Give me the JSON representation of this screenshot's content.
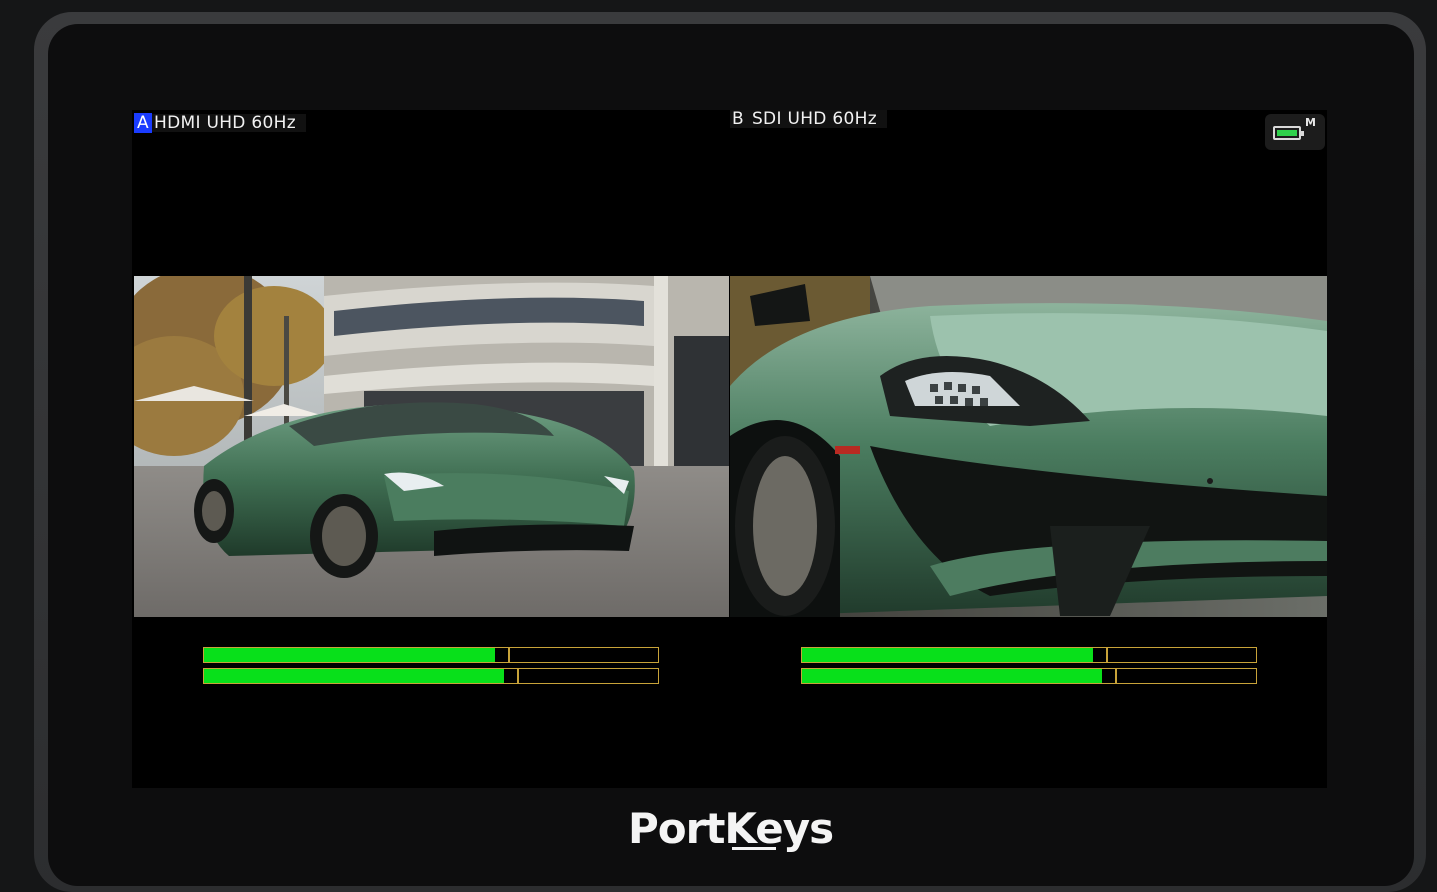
{
  "screen": {
    "source_a": {
      "badge": "A",
      "label": "HDMI  UHD  60Hz"
    },
    "source_b": {
      "badge": "B",
      "label": "SDI  UHD  60Hz"
    },
    "status": {
      "battery_icon": "battery-icon",
      "battery_mode": "M",
      "battery_color": "#2fd14b"
    }
  },
  "views": {
    "a": {
      "description_icon": "car-wide-shot-image"
    },
    "b": {
      "description_icon": "car-closeup-image"
    }
  },
  "audio_meters": {
    "a": [
      {
        "level": 0.64,
        "peak": 0.67
      },
      {
        "level": 0.66,
        "peak": 0.69
      }
    ],
    "b": [
      {
        "level": 0.64,
        "peak": 0.67
      },
      {
        "level": 0.66,
        "peak": 0.69
      }
    ],
    "fill_color": "#08e01a",
    "frame_color": "#c8a339"
  },
  "brand": {
    "logo": "PortKeys"
  }
}
